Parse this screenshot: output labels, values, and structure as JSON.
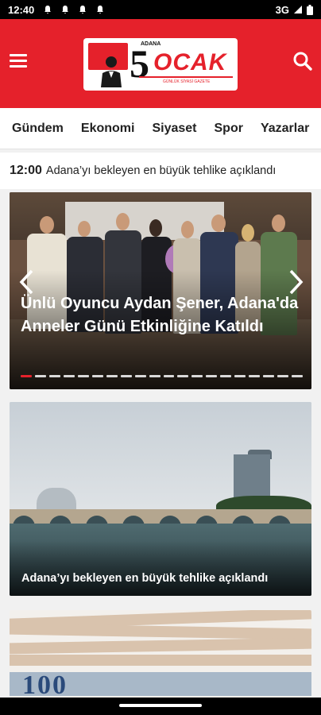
{
  "status_bar": {
    "time": "12:40",
    "network": "3G"
  },
  "header": {
    "logo": {
      "wordmark": "OCAK",
      "number": "5",
      "city": "ADANA",
      "tagline": "GÜNLÜK SİYASİ GAZETE"
    }
  },
  "categories": [
    "Gündem",
    "Ekonomi",
    "Siyaset",
    "Spor",
    "Yazarlar"
  ],
  "ticker": {
    "time": "12:00",
    "text": "Adana’yı bekleyen en büyük tehlike açıklandı"
  },
  "slider": {
    "headline": "Ünlü Oyuncu Aydan Şener, Adana'da Anneler Günü Etkinliğine Katıldı",
    "dot_count": 20,
    "active_dot": 0
  },
  "news": [
    {
      "headline": "Adana’yı bekleyen en büyük tehlike açıklandı"
    },
    {
      "headline": ""
    }
  ],
  "colors": {
    "brand_red": "#e5212b",
    "nav_bg": "#ffffff",
    "text_dark": "#222222"
  }
}
